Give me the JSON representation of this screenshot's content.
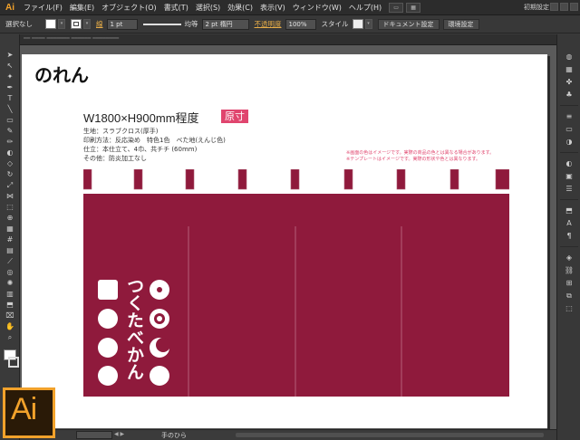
{
  "app": {
    "logo_small": "Ai",
    "logo_big": "Ai",
    "workspace": "初期設定"
  },
  "menu": {
    "items": [
      "ファイル(F)",
      "編集(E)",
      "オブジェクト(O)",
      "書式(T)",
      "選択(S)",
      "効果(C)",
      "表示(V)",
      "ウィンドウ(W)",
      "ヘルプ(H)"
    ]
  },
  "control": {
    "selection": "選択なし",
    "stroke_label": "線",
    "stroke_weight": "1 pt",
    "uniform": "均等",
    "brush": "2 pt 楕円",
    "opacity_label": "不透明度",
    "opacity_value": "100%",
    "style_label": "スタイル",
    "doc_settings": "ドキュメント設定",
    "env_settings": "環境設定"
  },
  "status": {
    "zoom": "",
    "tool": "手のひら"
  },
  "artboard": {
    "title": "のれん",
    "spec_title": "W1800×H900mm程度",
    "spec_badge": "原寸",
    "spec_lines": [
      "生地：スラブクロス(厚手)",
      "印刷方法：反応染め　特色1色　ベた地(えんじ色)",
      "仕立：本仕立て、4巾、共チチ (60mm)",
      "その他：防炎加工なし"
    ],
    "notes": [
      "※画面の色はイメージです。実際の商品の色とは異なる場合があります。",
      "※テンプレートはイメージです。実際の形状や色とは異なります。"
    ],
    "brand_text": "つくたべかん"
  },
  "colors": {
    "noren": "#8f1a3c",
    "badge": "#e0456e",
    "accent": "#f2a22b"
  }
}
